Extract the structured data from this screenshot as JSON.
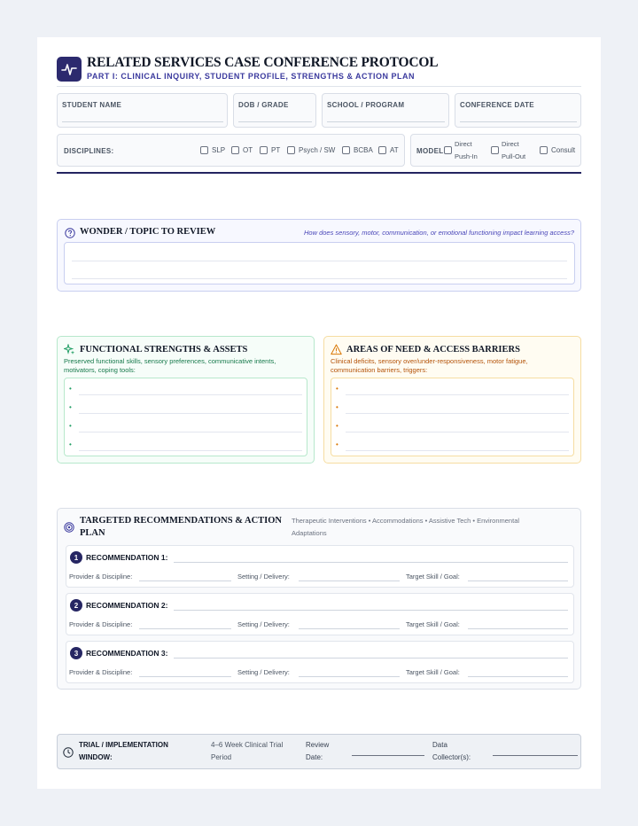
{
  "header": {
    "title": "RELATED SERVICES CASE CONFERENCE PROTOCOL",
    "subtitle": "PART I: CLINICAL INQUIRY, STUDENT PROFILE, STRENGTHS & ACTION PLAN",
    "logo_icon": "pulse-icon",
    "accent_color": "#2c2a6e"
  },
  "fields": {
    "student_name": "STUDENT NAME",
    "dob_grade": "DOB / GRADE",
    "school_program": "SCHOOL / PROGRAM",
    "conference_date": "CONFERENCE DATE"
  },
  "disciplines": {
    "label": "DISCIPLINES:",
    "options": [
      "SLP",
      "OT",
      "PT",
      "Psych / SW",
      "BCBA",
      "AT"
    ]
  },
  "model": {
    "label": "MODEL:",
    "direct_push_in_1": "Direct",
    "direct_push_in_2": "Push-In",
    "direct_pull_out_1": "Direct",
    "direct_pull_out_2": "Pull-Out",
    "consult": "Consult"
  },
  "wonder": {
    "title": "WONDER / TOPIC TO REVIEW",
    "hint": "How does sensory, motor, communication, or emotional functioning impact learning access?",
    "icon": "question-circle-icon"
  },
  "strengths": {
    "title": "FUNCTIONAL STRENGTHS & ASSETS",
    "desc_1": "Preserved functional skills, sensory preferences, communicative intents,",
    "desc_2": "motivators, coping tools:",
    "icon": "sparkle-icon",
    "color": "#1f9d63"
  },
  "needs": {
    "title": "AREAS OF NEED & ACCESS BARRIERS",
    "desc_1": "Clinical deficits, sensory over/under-responsiveness, motor fatigue,",
    "desc_2": "communication barriers, triggers:",
    "icon": "warning-triangle-icon",
    "color": "#d97706"
  },
  "recommendations": {
    "title_1": "TARGETED RECOMMENDATIONS & ACTION",
    "title_2": "PLAN",
    "categories_1": "Therapeutic Interventions • Accommodations • Assistive Tech • Environmental",
    "categories_2": "Adaptations",
    "icon": "target-icon",
    "items": [
      {
        "num": "1",
        "label": "RECOMMENDATION 1:"
      },
      {
        "num": "2",
        "label": "RECOMMENDATION 2:"
      },
      {
        "num": "3",
        "label": "RECOMMENDATION 3:"
      }
    ],
    "provider_label": "Provider & Discipline:",
    "setting_label": "Setting / Delivery:",
    "target_label": "Target Skill / Goal:"
  },
  "trial": {
    "title_1": "TRIAL / IMPLEMENTATION",
    "title_2": "WINDOW:",
    "period_1": "4–6 Week Clinical Trial",
    "period_2": "Period",
    "review_1": "Review",
    "review_2": "Date:",
    "collector_1": "Data",
    "collector_2": "Collector(s):",
    "icon": "clock-icon"
  }
}
